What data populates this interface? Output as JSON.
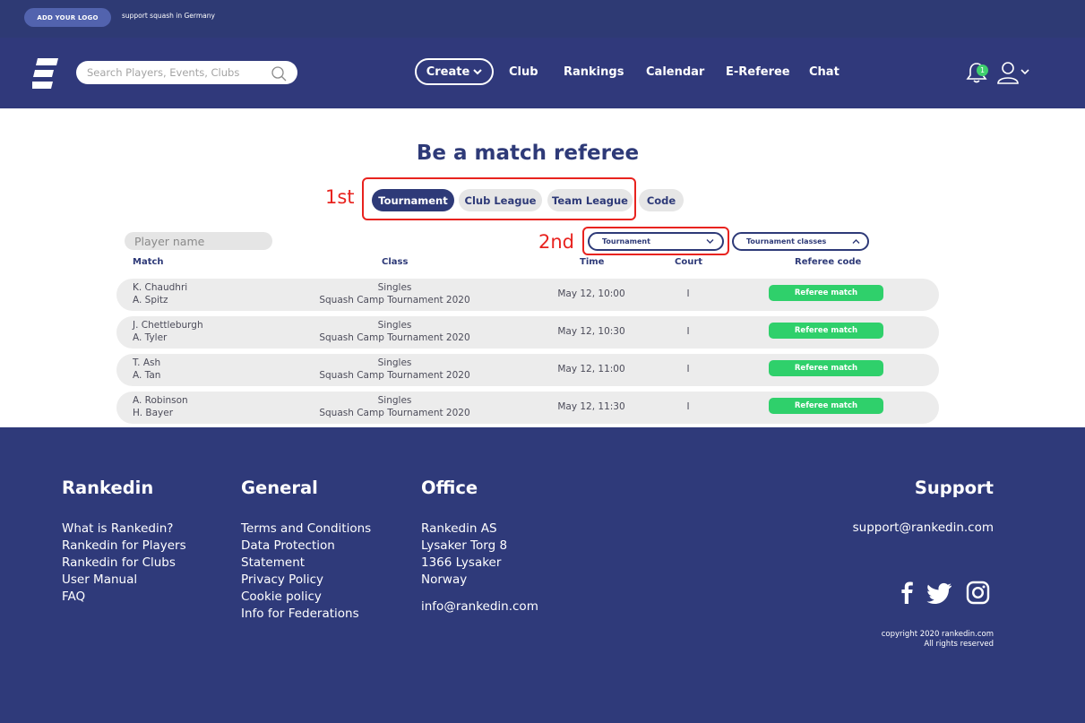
{
  "topstrip": {
    "logo_button": "ADD YOUR LOGO",
    "support_text": "support squash in Germany"
  },
  "header": {
    "search_placeholder": "Search Players, Events, Clubs",
    "create_label": "Create",
    "nav": [
      "Club",
      "Rankings",
      "Calendar",
      "E-Referee",
      "Chat"
    ],
    "notification_count": "1"
  },
  "main": {
    "title": "Be a match referee",
    "annotations": {
      "first": "1st",
      "second": "2nd"
    },
    "tabs": [
      {
        "label": "Tournament",
        "active": true
      },
      {
        "label": "Club League",
        "active": false
      },
      {
        "label": "Team League",
        "active": false
      },
      {
        "label": "Code",
        "active": false
      }
    ],
    "player_placeholder": "Player name",
    "filters": {
      "type": "Tournament",
      "classes": "Tournament classes"
    },
    "columns": [
      "Match",
      "Class",
      "Time",
      "Court",
      "Referee code"
    ],
    "rows": [
      {
        "p1": "K. Chaudhri",
        "p2": "A. Spitz",
        "class_type": "Singles",
        "tournament": "Squash Camp Tournament 2020",
        "time": "May 12, 10:00",
        "court": "I",
        "action": "Referee match"
      },
      {
        "p1": "J. Chettleburgh",
        "p2": "A. Tyler",
        "class_type": "Singles",
        "tournament": "Squash Camp Tournament 2020",
        "time": "May 12, 10:30",
        "court": "I",
        "action": "Referee match"
      },
      {
        "p1": "T. Ash",
        "p2": "A. Tan",
        "class_type": "Singles",
        "tournament": "Squash Camp Tournament 2020",
        "time": "May 12, 11:00",
        "court": "I",
        "action": "Referee match"
      },
      {
        "p1": "A. Robinson",
        "p2": "H. Bayer",
        "class_type": "Singles",
        "tournament": "Squash Camp Tournament 2020",
        "time": "May 12, 11:30",
        "court": "I",
        "action": "Referee match"
      }
    ]
  },
  "footer": {
    "rankedin": {
      "title": "Rankedin",
      "links": [
        "What is Rankedin?",
        "Rankedin for Players",
        "Rankedin for Clubs",
        "User Manual",
        "FAQ"
      ]
    },
    "general": {
      "title": "General",
      "links": [
        "Terms and Conditions",
        "Data Protection",
        "Statement",
        "Privacy Policy",
        "Cookie policy",
        "Info for Federations"
      ]
    },
    "office": {
      "title": "Office",
      "lines": [
        "Rankedin AS",
        "Lysaker Torg 8",
        "1366 Lysaker",
        "Norway"
      ],
      "email": "info@rankedin.com"
    },
    "support": {
      "title": "Support",
      "email": "support@rankedin.com"
    },
    "copyright": "copyright 2020 rankedin.com",
    "rights": "All rights reserved"
  },
  "colors": {
    "navy": "#2e3a78",
    "header_bg": "#30397b",
    "green": "#2fd06b",
    "annotation_red": "#e8231f"
  },
  "icons": [
    "brand-logo-icon",
    "search-icon",
    "chevron-down-icon",
    "bell-icon",
    "user-icon",
    "chevron-up-icon",
    "facebook-icon",
    "twitter-icon",
    "instagram-icon"
  ]
}
